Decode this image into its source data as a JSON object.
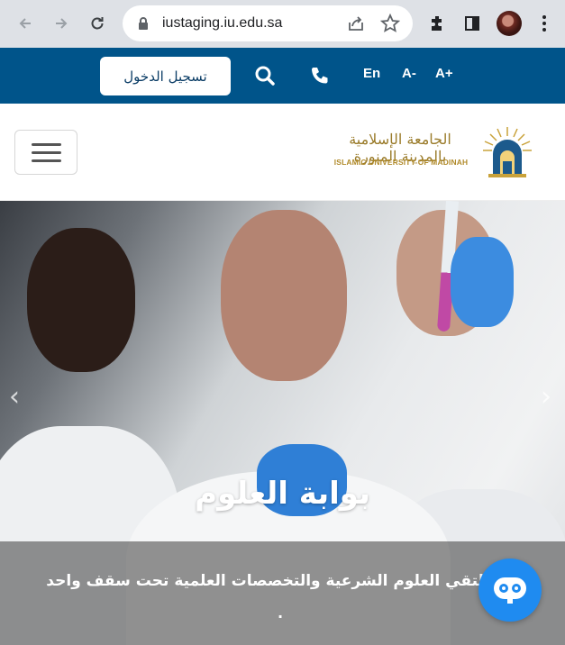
{
  "browser": {
    "url": "iustaging.iu.edu.sa",
    "icons": [
      "back-arrow-icon",
      "forward-arrow-icon",
      "reload-icon",
      "lock-icon",
      "share-icon",
      "star-icon",
      "extensions-icon",
      "sidepanel-icon",
      "profile-avatar",
      "kebab-menu-icon"
    ]
  },
  "topbar": {
    "login_label": "تسجيل الدخول",
    "lang_label": "En",
    "font_decrease": "A-",
    "font_increase": "A+",
    "icons": [
      "search-icon",
      "phone-icon"
    ],
    "bg_color": "#00548a"
  },
  "header": {
    "logo_ar": "الجامعة الإسلامية بالمدينة المنورة",
    "logo_en": "ISLAMIC UNIVERSITY OF MADINAH",
    "menu_icon": "hamburger-icon"
  },
  "hero": {
    "title": "بوابة العلوم",
    "subtitle": "ملتقي العلوم الشرعية والتخصصات العلمية تحت سقف واحد",
    "trailing": "."
  },
  "chatbot": {
    "icon": "chatbot-icon",
    "color": "#1f8bf0"
  }
}
